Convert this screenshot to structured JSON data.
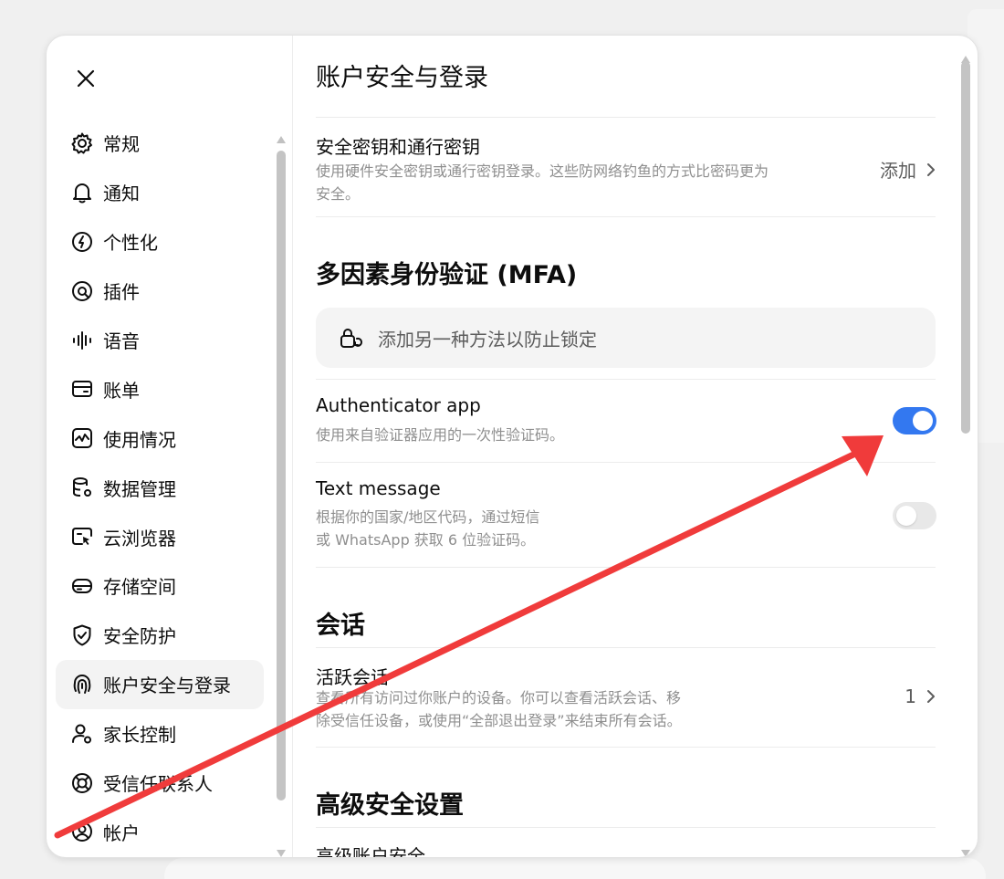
{
  "sidebar": {
    "items": [
      {
        "label": "常规",
        "icon": "gear-icon"
      },
      {
        "label": "通知",
        "icon": "bell-icon"
      },
      {
        "label": "个性化",
        "icon": "personalization-icon"
      },
      {
        "label": "插件",
        "icon": "plugin-icon"
      },
      {
        "label": "语音",
        "icon": "voice-wave-icon"
      },
      {
        "label": "账单",
        "icon": "card-icon"
      },
      {
        "label": "使用情况",
        "icon": "usage-chart-icon"
      },
      {
        "label": "数据管理",
        "icon": "database-icon"
      },
      {
        "label": "云浏览器",
        "icon": "cloud-browser-icon"
      },
      {
        "label": "存储空间",
        "icon": "storage-icon"
      },
      {
        "label": "安全防护",
        "icon": "shield-icon"
      },
      {
        "label": "账户安全与登录",
        "icon": "fingerprint-icon",
        "active": true
      },
      {
        "label": "家长控制",
        "icon": "parent-user-icon"
      },
      {
        "label": "受信任联系人",
        "icon": "lifebuoy-icon"
      },
      {
        "label": "帐户",
        "icon": "user-circle-icon"
      }
    ]
  },
  "main": {
    "title": "账户安全与登录",
    "passkeys": {
      "title": "安全密钥和通行密钥",
      "desc_line1": "使用硬件安全密钥或通行密钥登录。这些防网络钓鱼的方式比密码更为",
      "desc_line2": "安全。",
      "action": "添加"
    },
    "mfa": {
      "section_title": "多因素身份验证 (MFA)",
      "callout": "添加另一种方法以防止锁定",
      "authenticator": {
        "title": "Authenticator app",
        "desc": "使用来自验证器应用的一次性验证码。",
        "enabled": true
      },
      "sms": {
        "title": "Text message",
        "desc_line1": "根据你的国家/地区代码，通过短信",
        "desc_line2": "或 WhatsApp 获取 6 位验证码。",
        "enabled": false
      }
    },
    "sessions": {
      "section_title": "会话",
      "active_title": "活跃会话",
      "desc_line1": "查看所有访问过你账户的设备。你可以查看活跃会话、移",
      "desc_line2": "除受信任设备，或使用“全部退出登录”来结束所有会话。",
      "count": "1"
    },
    "advanced": {
      "section_title": "高级安全设置",
      "first_row": "高级账户安全"
    }
  },
  "colors": {
    "toggle_on": "#3378f0",
    "annotation_arrow": "#f03b3b"
  }
}
